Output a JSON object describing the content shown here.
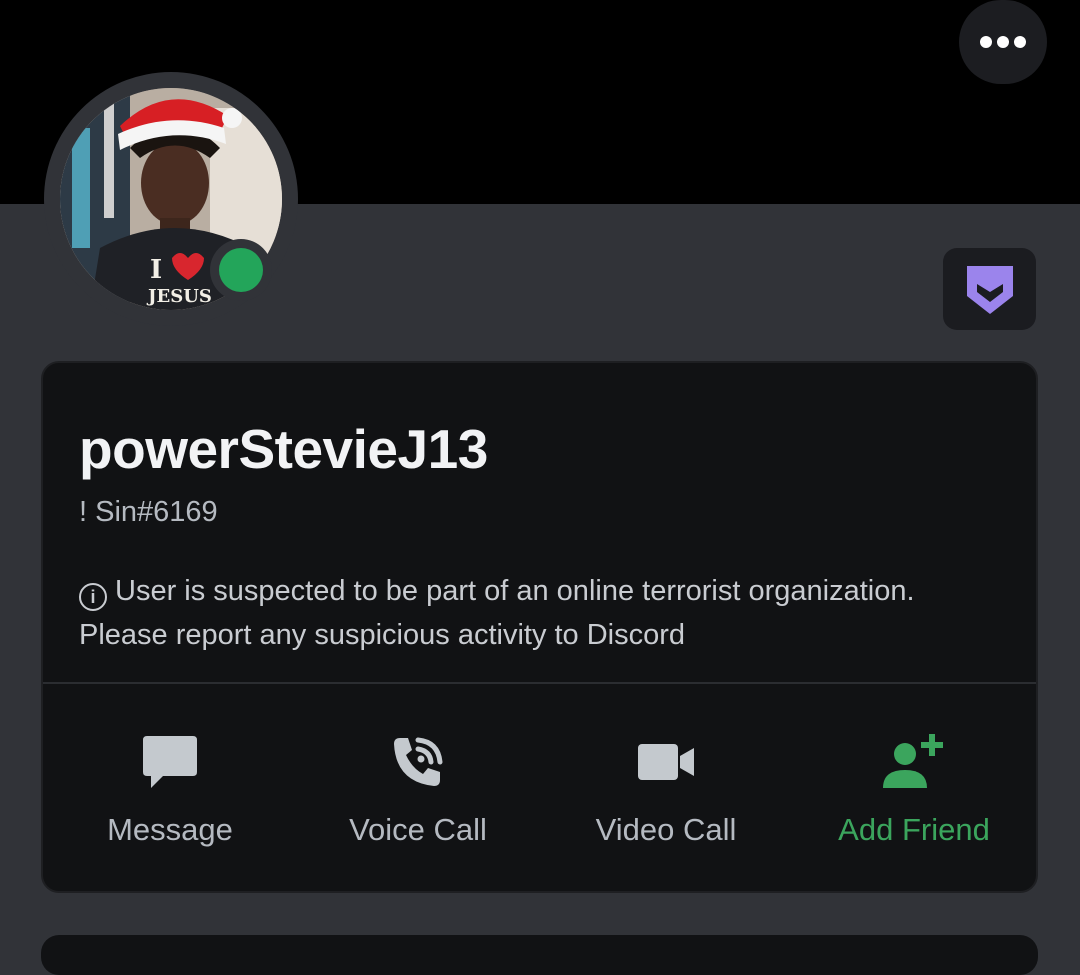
{
  "profile": {
    "display_name": "powerStevieJ13",
    "tag": "! Sin#6169",
    "notice": "User is suspected to be part of an online terrorist organization. Please report any suspicious activity to Discord",
    "status": "online",
    "status_color": "#23a55a"
  },
  "header": {
    "more_icon": "more-dots-icon"
  },
  "badge": {
    "icon": "hypesquad-badge-icon",
    "color": "#9b84ec"
  },
  "actions": [
    {
      "label": "Message",
      "icon": "chat-bubble-icon"
    },
    {
      "label": "Voice Call",
      "icon": "phone-call-icon"
    },
    {
      "label": "Video Call",
      "icon": "video-camera-icon"
    },
    {
      "label": "Add Friend",
      "icon": "add-friend-icon",
      "color": "#3ba55d"
    }
  ]
}
